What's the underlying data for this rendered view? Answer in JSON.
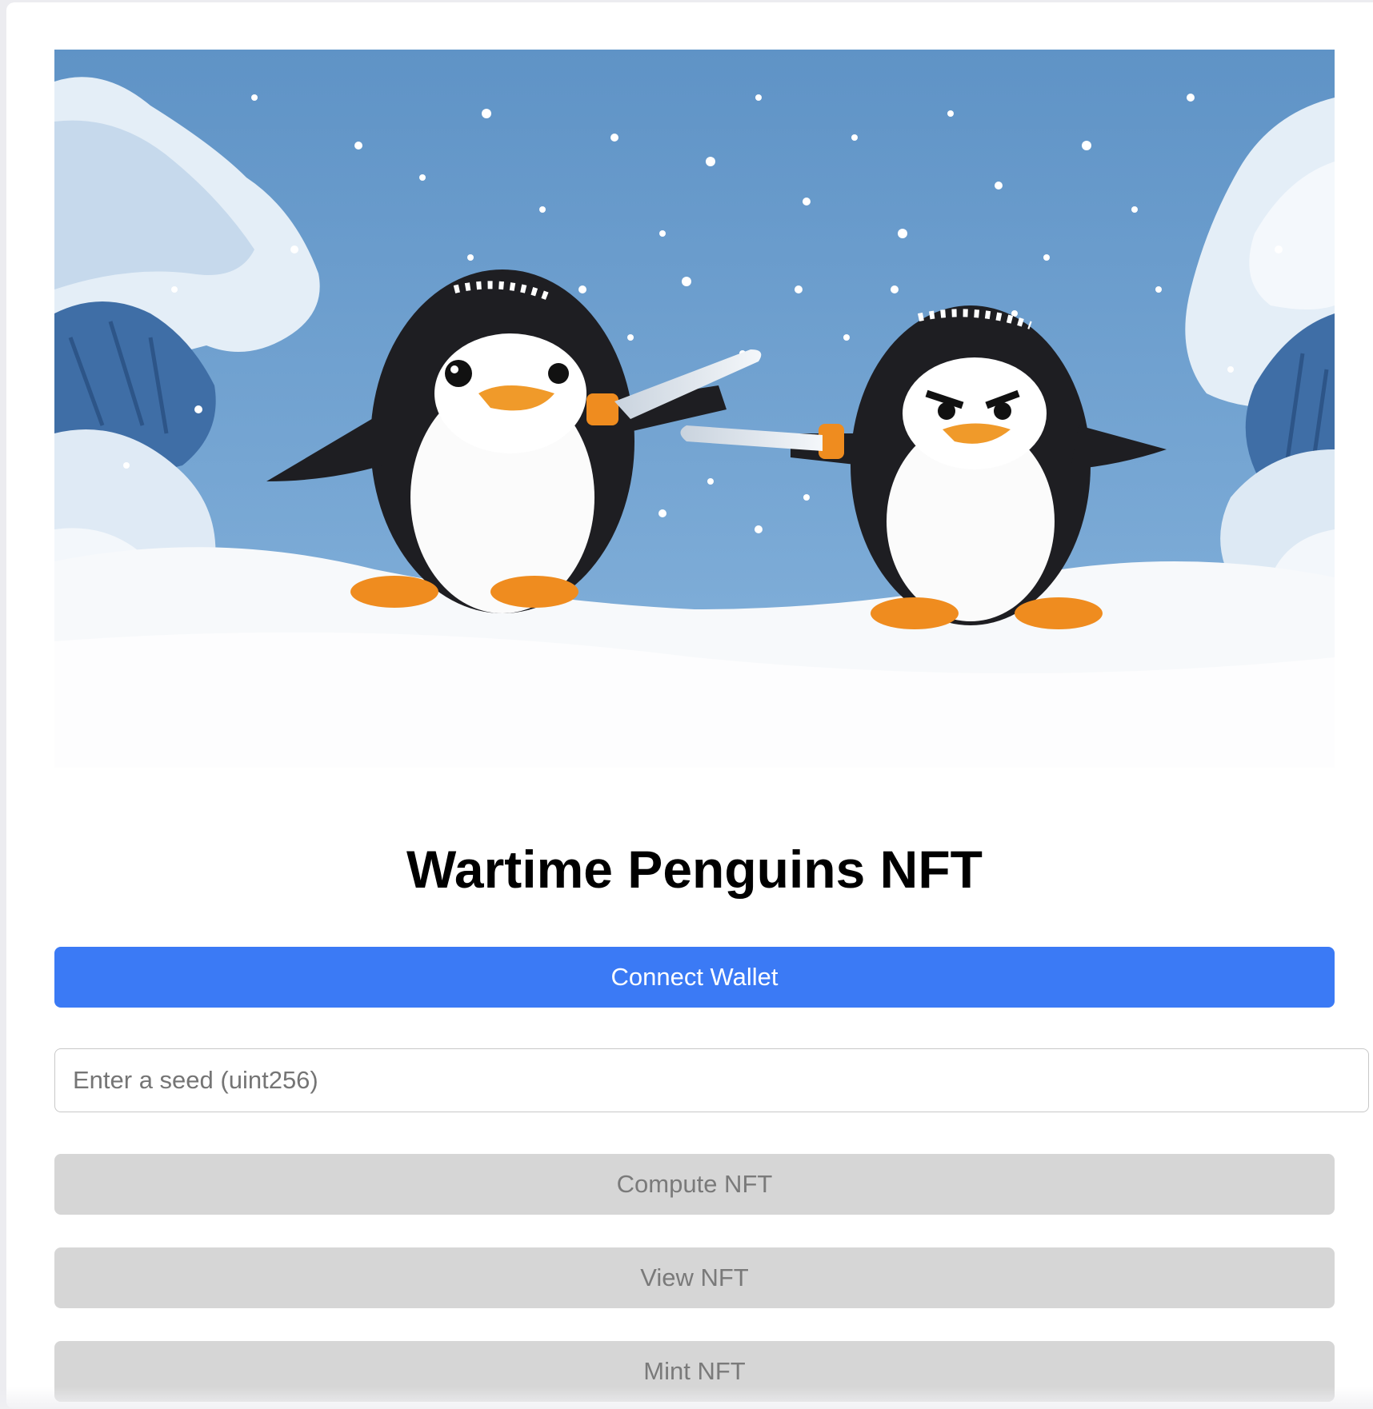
{
  "app": {
    "title": "Wartime Penguins NFT"
  },
  "hero": {
    "image_name": "snowy-penguin-sword-fight-illustration"
  },
  "actions": {
    "connect_label": "Connect Wallet",
    "compute_label": "Compute NFT",
    "view_label": "View NFT",
    "mint_label": "Mint NFT"
  },
  "seed": {
    "value": "",
    "placeholder": "Enter a seed (uint256)"
  },
  "colors": {
    "primary": "#3b7af5",
    "disabled_bg": "#d6d6d6",
    "disabled_text": "#7a7a7a",
    "sky": "#6b9fcf"
  }
}
